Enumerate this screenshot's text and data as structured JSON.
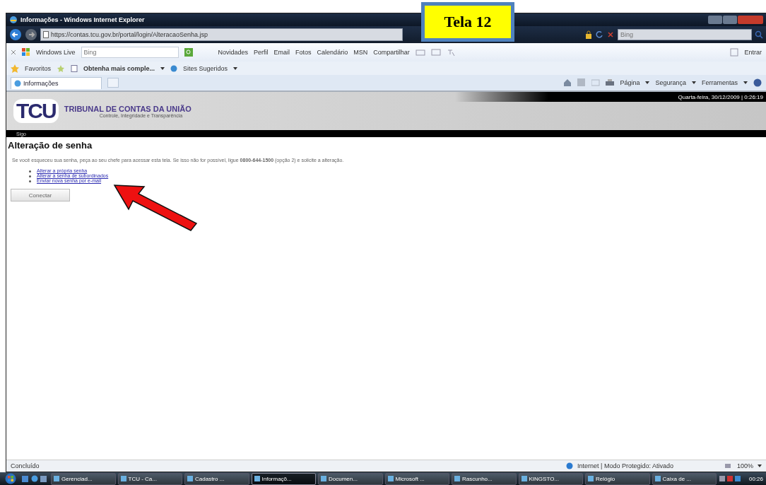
{
  "window": {
    "title": "Informações - Windows Internet Explorer"
  },
  "address_bar": {
    "url": "https://contas.tcu.gov.br/portal/login/AlteracaoSenha.jsp",
    "search_placeholder": "Bing"
  },
  "live_toolbar": {
    "brand": "Windows Live",
    "search_placeholder": "Bing",
    "links": [
      "Novidades",
      "Perfil",
      "Email",
      "Fotos",
      "Calendário",
      "MSN",
      "Compartilhar"
    ],
    "signin": "Entrar"
  },
  "favorites_bar": {
    "label": "Favoritos",
    "items": [
      "Obtenha mais comple...",
      "Sites Sugeridos"
    ]
  },
  "tabs": [
    {
      "label": "Informações",
      "selected": true
    }
  ],
  "command_bar": [
    "Página",
    "Segurança",
    "Ferramentas"
  ],
  "site": {
    "title": "TRIBUNAL DE CONTAS DA UNIÃO",
    "subtitle": "Controle, Integridade e Transparência",
    "logo": "TCU",
    "datetime": "Quarta-feira, 30/12/2009 | 0:26:19",
    "nav": "Sigo"
  },
  "page": {
    "heading": "Alteração de senha",
    "intro": "Se você esqueceu sua senha, peça ao seu chefe para acessar esta tela. Se isso não for possível, ligue **0800-644-1500** (opção 2) e solicite a alteração.",
    "links": [
      "Alterar a própria senha",
      "Alterar a senha de subordinados",
      "Enviar nova senha por e-mail"
    ],
    "button": "Conectar"
  },
  "status_bar": {
    "status": "Concluído",
    "zone": "Internet | Modo Protegido: Ativado",
    "zoom": "100%"
  },
  "taskbar": {
    "items": [
      {
        "label": "Gerenciad...",
        "selected": false
      },
      {
        "label": "TCU - Ca...",
        "selected": false
      },
      {
        "label": "Cadastro ...",
        "selected": false
      },
      {
        "label": "Informaçõ...",
        "selected": true
      },
      {
        "label": "Documen...",
        "selected": false
      },
      {
        "label": "Microsoft ...",
        "selected": false
      },
      {
        "label": "Rascunho...",
        "selected": false
      },
      {
        "label": "KINGSTO...",
        "selected": false
      },
      {
        "label": "Relógio",
        "selected": false
      },
      {
        "label": "Caixa de ...",
        "selected": false
      }
    ],
    "clock": "00:26"
  },
  "annotation": {
    "label": "Tela 12"
  }
}
